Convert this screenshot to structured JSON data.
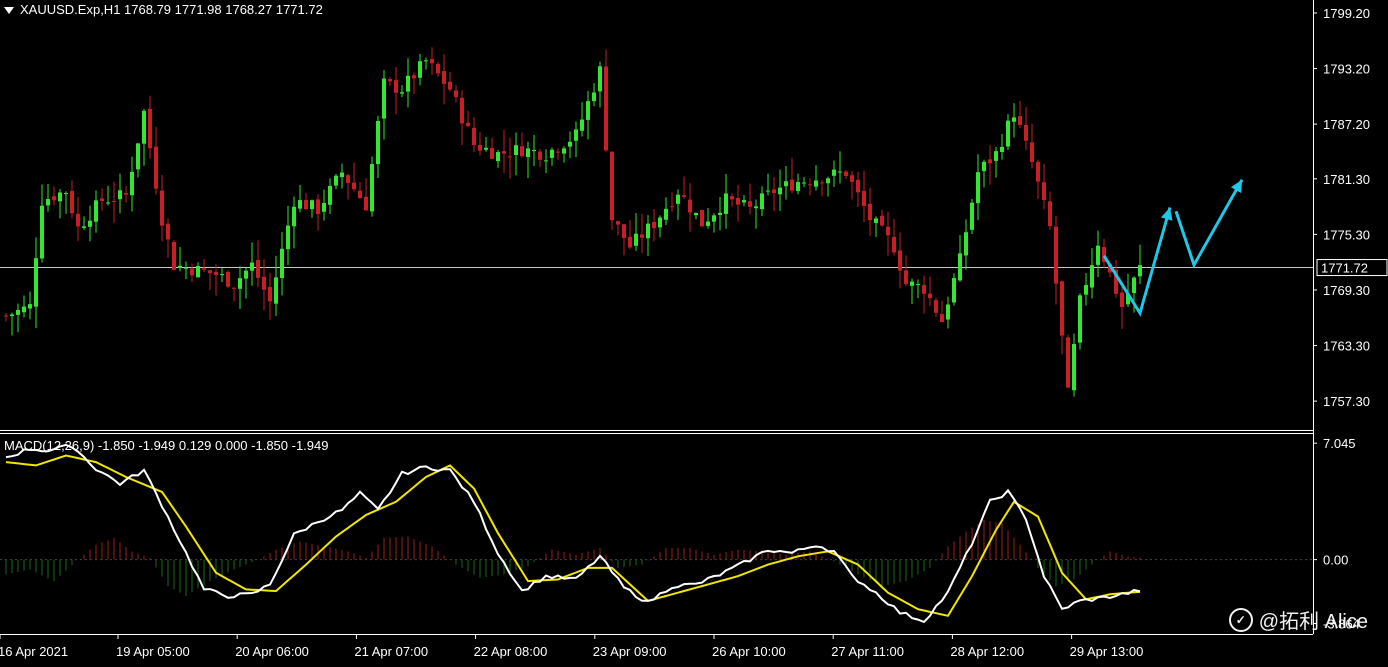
{
  "symbol_header": "XAUUSD.Exp,H1  1768.79 1771.98 1768.27 1771.72",
  "macd_header": "MACD(12,26,9) -1.850 -1.949 0.129 0.000 -1.850 -1.949",
  "current_price_label": "1771.72",
  "watermark": "@拓利 Alice",
  "colors": {
    "bull": "#32e632",
    "bear": "#c81e28",
    "macd_main": "#ffffff",
    "macd_signal": "#f0e600",
    "arrow": "#1ec8e6",
    "grid": "#c8c8c8"
  },
  "chart_data": [
    {
      "type": "candlestick",
      "price_axis_ticks": [
        "1799.20",
        "1793.20",
        "1787.20",
        "1781.30",
        "1775.30",
        "1769.30",
        "1763.30",
        "1757.30"
      ],
      "price_axis_values": [
        1799.2,
        1793.2,
        1787.2,
        1781.3,
        1775.3,
        1769.3,
        1763.3,
        1757.3
      ],
      "ylim": [
        1754.4,
        1800.6
      ],
      "current_price": 1771.72,
      "time_labels": [
        "16 Apr 2021",
        "19 Apr 05:00",
        "20 Apr 06:00",
        "21 Apr 07:00",
        "22 Apr 08:00",
        "23 Apr 09:00",
        "26 Apr 10:00",
        "27 Apr 11:00",
        "28 Apr 12:00",
        "29 Apr 13:00"
      ],
      "candle_count": 190,
      "close_path": [
        {
          "i": 0,
          "v": 1766.5
        },
        {
          "i": 4,
          "v": 1767.5
        },
        {
          "i": 6,
          "v": 1779.0
        },
        {
          "i": 10,
          "v": 1780.0
        },
        {
          "i": 12,
          "v": 1776.0
        },
        {
          "i": 16,
          "v": 1779.0
        },
        {
          "i": 20,
          "v": 1779.5
        },
        {
          "i": 23,
          "v": 1788.5
        },
        {
          "i": 26,
          "v": 1777.0
        },
        {
          "i": 28,
          "v": 1772.0
        },
        {
          "i": 35,
          "v": 1771.0
        },
        {
          "i": 38,
          "v": 1770.0
        },
        {
          "i": 41,
          "v": 1772.0
        },
        {
          "i": 44,
          "v": 1768.0
        },
        {
          "i": 48,
          "v": 1779.0
        },
        {
          "i": 52,
          "v": 1778.0
        },
        {
          "i": 56,
          "v": 1782.0
        },
        {
          "i": 60,
          "v": 1778.5
        },
        {
          "i": 63,
          "v": 1791.5
        },
        {
          "i": 66,
          "v": 1791.0
        },
        {
          "i": 70,
          "v": 1794.0
        },
        {
          "i": 74,
          "v": 1791.0
        },
        {
          "i": 78,
          "v": 1785.0
        },
        {
          "i": 82,
          "v": 1784.0
        },
        {
          "i": 86,
          "v": 1784.5
        },
        {
          "i": 90,
          "v": 1784.0
        },
        {
          "i": 95,
          "v": 1786.0
        },
        {
          "i": 99,
          "v": 1793.0
        },
        {
          "i": 101,
          "v": 1777.0
        },
        {
          "i": 104,
          "v": 1774.0
        },
        {
          "i": 108,
          "v": 1776.5
        },
        {
          "i": 112,
          "v": 1780.0
        },
        {
          "i": 116,
          "v": 1776.5
        },
        {
          "i": 120,
          "v": 1779.0
        },
        {
          "i": 124,
          "v": 1778.0
        },
        {
          "i": 128,
          "v": 1780.0
        },
        {
          "i": 132,
          "v": 1781.0
        },
        {
          "i": 136,
          "v": 1781.5
        },
        {
          "i": 140,
          "v": 1782.0
        },
        {
          "i": 144,
          "v": 1777.0
        },
        {
          "i": 148,
          "v": 1774.0
        },
        {
          "i": 150,
          "v": 1770.0
        },
        {
          "i": 153,
          "v": 1769.5
        },
        {
          "i": 156,
          "v": 1766.0
        },
        {
          "i": 159,
          "v": 1772.5
        },
        {
          "i": 162,
          "v": 1782.0
        },
        {
          "i": 165,
          "v": 1784.0
        },
        {
          "i": 168,
          "v": 1788.5
        },
        {
          "i": 171,
          "v": 1783.0
        },
        {
          "i": 174,
          "v": 1776.0
        },
        {
          "i": 177,
          "v": 1758.0
        },
        {
          "i": 179,
          "v": 1768.0
        },
        {
          "i": 182,
          "v": 1774.5
        },
        {
          "i": 186,
          "v": 1767.5
        },
        {
          "i": 189,
          "v": 1771.7
        }
      ],
      "projection_arrows": [
        [
          {
            "i": 183,
            "v": 1773.0
          },
          {
            "i": 189,
            "v": 1766.8
          },
          {
            "i": 194,
            "v": 1778.2
          }
        ],
        [
          {
            "i": 195,
            "v": 1777.8
          },
          {
            "i": 198,
            "v": 1772.0
          },
          {
            "i": 206,
            "v": 1781.2
          }
        ]
      ]
    },
    {
      "type": "macd",
      "name": "MACD(12,26,9)",
      "axis_ticks": [
        "7.045",
        "0.00",
        "-3.864"
      ],
      "axis_values": [
        7.045,
        0.0,
        -3.864
      ],
      "ylim": [
        -4.5,
        7.6
      ],
      "main_path": [
        {
          "i": 0,
          "v": 6.2
        },
        {
          "i": 4,
          "v": 6.7
        },
        {
          "i": 7,
          "v": 6.6
        },
        {
          "i": 11,
          "v": 6.9
        },
        {
          "i": 15,
          "v": 5.5
        },
        {
          "i": 19,
          "v": 4.6
        },
        {
          "i": 23,
          "v": 5.4
        },
        {
          "i": 26,
          "v": 3.3
        },
        {
          "i": 30,
          "v": 0.4
        },
        {
          "i": 33,
          "v": -1.8
        },
        {
          "i": 37,
          "v": -2.2
        },
        {
          "i": 41,
          "v": -2.1
        },
        {
          "i": 44,
          "v": -1.5
        },
        {
          "i": 48,
          "v": 1.5
        },
        {
          "i": 52,
          "v": 2.3
        },
        {
          "i": 56,
          "v": 3.0
        },
        {
          "i": 59,
          "v": 4.0
        },
        {
          "i": 62,
          "v": 3.0
        },
        {
          "i": 66,
          "v": 5.2
        },
        {
          "i": 70,
          "v": 5.6
        },
        {
          "i": 74,
          "v": 5.4
        },
        {
          "i": 78,
          "v": 3.5
        },
        {
          "i": 82,
          "v": 0.4
        },
        {
          "i": 86,
          "v": -1.9
        },
        {
          "i": 90,
          "v": -1.0
        },
        {
          "i": 95,
          "v": -1.2
        },
        {
          "i": 99,
          "v": 0.2
        },
        {
          "i": 103,
          "v": -1.7
        },
        {
          "i": 107,
          "v": -2.6
        },
        {
          "i": 111,
          "v": -1.6
        },
        {
          "i": 115,
          "v": -1.5
        },
        {
          "i": 119,
          "v": -0.9
        },
        {
          "i": 123,
          "v": -0.2
        },
        {
          "i": 127,
          "v": 0.6
        },
        {
          "i": 131,
          "v": 0.4
        },
        {
          "i": 135,
          "v": 0.9
        },
        {
          "i": 138,
          "v": 0.5
        },
        {
          "i": 141,
          "v": -1.0
        },
        {
          "i": 145,
          "v": -2.0
        },
        {
          "i": 149,
          "v": -3.2
        },
        {
          "i": 153,
          "v": -3.7
        },
        {
          "i": 157,
          "v": -2.0
        },
        {
          "i": 161,
          "v": 1.0
        },
        {
          "i": 164,
          "v": 3.5
        },
        {
          "i": 167,
          "v": 4.1
        },
        {
          "i": 170,
          "v": 2.5
        },
        {
          "i": 173,
          "v": -1.0
        },
        {
          "i": 176,
          "v": -3.0
        },
        {
          "i": 179,
          "v": -2.5
        },
        {
          "i": 183,
          "v": -2.3
        },
        {
          "i": 186,
          "v": -2.1
        },
        {
          "i": 189,
          "v": -1.85
        }
      ],
      "signal_path": [
        {
          "i": 0,
          "v": 5.9
        },
        {
          "i": 5,
          "v": 5.7
        },
        {
          "i": 10,
          "v": 6.3
        },
        {
          "i": 15,
          "v": 5.9
        },
        {
          "i": 20,
          "v": 5.0
        },
        {
          "i": 26,
          "v": 4.1
        },
        {
          "i": 30,
          "v": 2.0
        },
        {
          "i": 35,
          "v": -0.8
        },
        {
          "i": 40,
          "v": -1.8
        },
        {
          "i": 45,
          "v": -1.9
        },
        {
          "i": 50,
          "v": -0.3
        },
        {
          "i": 55,
          "v": 1.4
        },
        {
          "i": 60,
          "v": 2.7
        },
        {
          "i": 65,
          "v": 3.5
        },
        {
          "i": 70,
          "v": 5.0
        },
        {
          "i": 74,
          "v": 5.7
        },
        {
          "i": 78,
          "v": 4.3
        },
        {
          "i": 82,
          "v": 1.6
        },
        {
          "i": 87,
          "v": -1.3
        },
        {
          "i": 92,
          "v": -1.2
        },
        {
          "i": 97,
          "v": -0.5
        },
        {
          "i": 101,
          "v": -0.5
        },
        {
          "i": 107,
          "v": -2.5
        },
        {
          "i": 112,
          "v": -2.0
        },
        {
          "i": 117,
          "v": -1.5
        },
        {
          "i": 122,
          "v": -1.0
        },
        {
          "i": 127,
          "v": -0.3
        },
        {
          "i": 132,
          "v": 0.2
        },
        {
          "i": 137,
          "v": 0.5
        },
        {
          "i": 142,
          "v": -0.3
        },
        {
          "i": 147,
          "v": -2.0
        },
        {
          "i": 152,
          "v": -3.0
        },
        {
          "i": 157,
          "v": -3.4
        },
        {
          "i": 161,
          "v": -1.0
        },
        {
          "i": 165,
          "v": 1.8
        },
        {
          "i": 168,
          "v": 3.5
        },
        {
          "i": 172,
          "v": 2.6
        },
        {
          "i": 176,
          "v": -0.8
        },
        {
          "i": 180,
          "v": -2.4
        },
        {
          "i": 184,
          "v": -2.1
        },
        {
          "i": 189,
          "v": -1.95
        }
      ],
      "histogram_path": [
        {
          "i": 0,
          "v": -0.9
        },
        {
          "i": 4,
          "v": -0.6
        },
        {
          "i": 8,
          "v": -1.3
        },
        {
          "i": 12,
          "v": 0.0
        },
        {
          "i": 15,
          "v": 0.9
        },
        {
          "i": 18,
          "v": 1.3
        },
        {
          "i": 21,
          "v": 0.5
        },
        {
          "i": 24,
          "v": 0.1
        },
        {
          "i": 27,
          "v": -1.6
        },
        {
          "i": 30,
          "v": -2.2
        },
        {
          "i": 34,
          "v": -1.3
        },
        {
          "i": 38,
          "v": -0.6
        },
        {
          "i": 42,
          "v": 0.0
        },
        {
          "i": 45,
          "v": 0.6
        },
        {
          "i": 49,
          "v": 1.1
        },
        {
          "i": 53,
          "v": 0.8
        },
        {
          "i": 57,
          "v": 0.5
        },
        {
          "i": 60,
          "v": 0.1
        },
        {
          "i": 63,
          "v": 1.3
        },
        {
          "i": 67,
          "v": 1.4
        },
        {
          "i": 71,
          "v": 0.8
        },
        {
          "i": 75,
          "v": -0.3
        },
        {
          "i": 79,
          "v": -1.1
        },
        {
          "i": 83,
          "v": -0.9
        },
        {
          "i": 87,
          "v": -0.4
        },
        {
          "i": 91,
          "v": 0.6
        },
        {
          "i": 95,
          "v": 0.3
        },
        {
          "i": 99,
          "v": 0.7
        },
        {
          "i": 102,
          "v": -0.5
        },
        {
          "i": 106,
          "v": -0.3
        },
        {
          "i": 110,
          "v": 0.7
        },
        {
          "i": 114,
          "v": 0.7
        },
        {
          "i": 118,
          "v": 0.3
        },
        {
          "i": 122,
          "v": 0.6
        },
        {
          "i": 126,
          "v": 0.5
        },
        {
          "i": 130,
          "v": 0.3
        },
        {
          "i": 134,
          "v": 0.5
        },
        {
          "i": 138,
          "v": -0.1
        },
        {
          "i": 142,
          "v": -0.9
        },
        {
          "i": 146,
          "v": -1.6
        },
        {
          "i": 150,
          "v": -1.3
        },
        {
          "i": 154,
          "v": -0.5
        },
        {
          "i": 157,
          "v": 0.8
        },
        {
          "i": 160,
          "v": 1.7
        },
        {
          "i": 163,
          "v": 2.4
        },
        {
          "i": 166,
          "v": 2.2
        },
        {
          "i": 169,
          "v": 0.9
        },
        {
          "i": 172,
          "v": -0.5
        },
        {
          "i": 175,
          "v": -1.6
        },
        {
          "i": 178,
          "v": -1.2
        },
        {
          "i": 181,
          "v": -0.3
        },
        {
          "i": 184,
          "v": 0.5
        },
        {
          "i": 187,
          "v": 0.2
        },
        {
          "i": 189,
          "v": 0.13
        }
      ]
    }
  ]
}
